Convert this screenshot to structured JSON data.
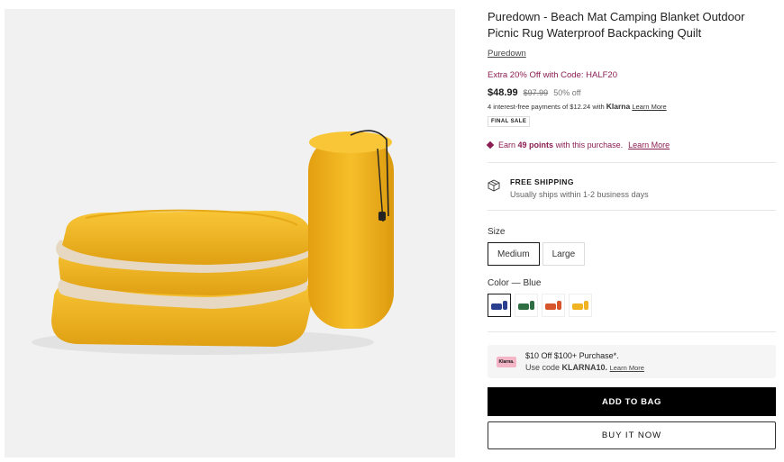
{
  "product": {
    "title": "Puredown - Beach Mat Camping Blanket Outdoor Picnic Rug Waterproof Backpacking Quilt",
    "brand": "Puredown",
    "promo": "Extra 20% Off with Code: HALF20",
    "price": "$48.99",
    "compare_price": "$97.99",
    "discount": "50% off",
    "klarna_prefix": "4 interest-free payments of $12.24 with",
    "klarna_brand": "Klarna",
    "klarna_link": "Learn More",
    "final_sale": "FINAL SALE",
    "points_earn": "Earn",
    "points_value": "49 points",
    "points_suffix": "with this purchase.",
    "points_link": "Learn More",
    "image_icon": "rolled-and-folded-yellow-blanket-photo"
  },
  "shipping": {
    "icon": "box-icon",
    "title": "FREE SHIPPING",
    "subtitle": "Usually ships within 1-2 business days"
  },
  "size": {
    "label": "Size",
    "options": [
      "Medium",
      "Large"
    ],
    "selected": "Medium"
  },
  "color": {
    "label": "Color — Blue",
    "swatches": [
      {
        "name": "blue",
        "hex": "#2b3f8f",
        "selected": true
      },
      {
        "name": "green",
        "hex": "#2f6d43",
        "selected": false
      },
      {
        "name": "orange",
        "hex": "#d6552a",
        "selected": false
      },
      {
        "name": "yellow",
        "hex": "#f0b423",
        "selected": false
      }
    ]
  },
  "klarna_promo": {
    "logo": "Klarna.",
    "line1": "$10 Off $100+ Purchase*.",
    "line2_prefix": "Use code",
    "code": "KLARNA10.",
    "link": "Learn More"
  },
  "actions": {
    "add_to_bag": "ADD TO BAG",
    "buy_now": "BUY IT NOW"
  },
  "colors": {
    "accent": "#8a1d51",
    "product_yellow": "#f2b41c",
    "lining_beige": "#e3d6c4"
  }
}
